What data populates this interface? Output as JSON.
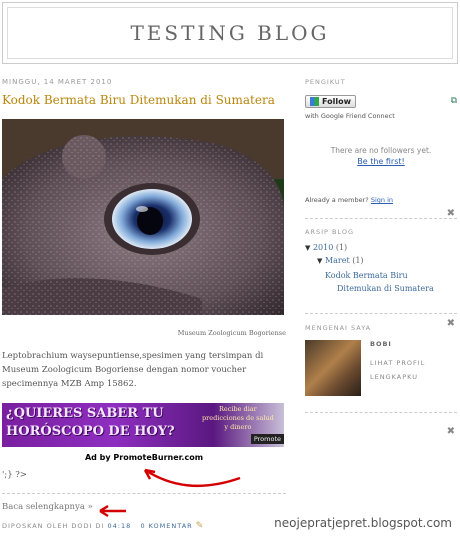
{
  "blog": {
    "title": "TESTING BLOG"
  },
  "post": {
    "date": "MINGGU, 14 MARET 2010",
    "title": "Kodok Bermata Biru Ditemukan di Sumatera",
    "image_caption": "Museum Zoologicum Bogoriense",
    "body": "Leptobrachium waysepuntiense,spesimen yang tersimpan di Museum Zoologicum Bogoriense dengan nomor voucher specimennya MZB Amp 15862.",
    "ad": {
      "headline_1": "¿QUIERES SABER TU",
      "headline_2": "HORÓSCOPO DE HOY?",
      "side_line_1": "Recibe diar",
      "side_line_2": "predicciones de salud",
      "side_line_3": "y dinero",
      "button": "Promote",
      "credit": "Ad by PromoteBurner.com"
    },
    "code_fragment": "';} ?>",
    "read_more": "Baca selengkapnya »",
    "footer": {
      "posted_by": "DIPOSKAN OLEH DODI DI",
      "time": "04:18",
      "comments": "0 KOMENTAR"
    }
  },
  "sidebar": {
    "followers": {
      "title": "PENGIKUT",
      "follow_button": "Follow",
      "gfc_text": "with Google Friend Connect",
      "no_followers": "There are no followers yet.",
      "be_first": "Be the first!",
      "already_member": "Already a member?",
      "sign_in": "Sign in"
    },
    "archive": {
      "title": "ARSIP BLOG",
      "year": "2010",
      "year_count": "(1)",
      "month": "Maret",
      "month_count": "(1)",
      "post_line_1": "Kodok Bermata Biru",
      "post_line_2": "Ditemukan di Sumatera"
    },
    "about": {
      "title": "MENGENAI SAYA",
      "name": "BOBI",
      "profile_1": "LIHAT PROFIL",
      "profile_2": "LENGKAPKU"
    }
  },
  "watermark": "neojepratjepret.blogspot.com",
  "colors": {
    "post_title": "#b8860b",
    "link": "#2a5db0",
    "arrow": "#d40000"
  }
}
